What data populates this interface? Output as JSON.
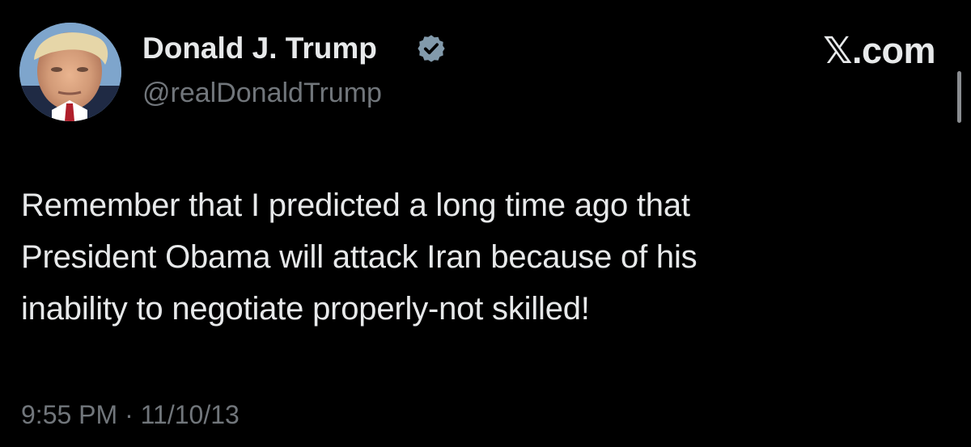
{
  "author": {
    "display_name": "Donald J. Trump",
    "handle": "@realDonaldTrump",
    "verified": true,
    "avatar_icon": "profile-photo"
  },
  "brand": {
    "label": "𝕏.com"
  },
  "tweet": {
    "lines": [
      "Remember that I predicted a long time ago that",
      "President Obama will attack Iran because of his",
      "inability to negotiate properly-not skilled!"
    ]
  },
  "meta": {
    "timestamp": "9:55 PM · 11/10/13"
  },
  "colors": {
    "background": "#000000",
    "primary_text": "#e7e9ea",
    "secondary_text": "#71767b",
    "verified_badge": "#829aab"
  }
}
